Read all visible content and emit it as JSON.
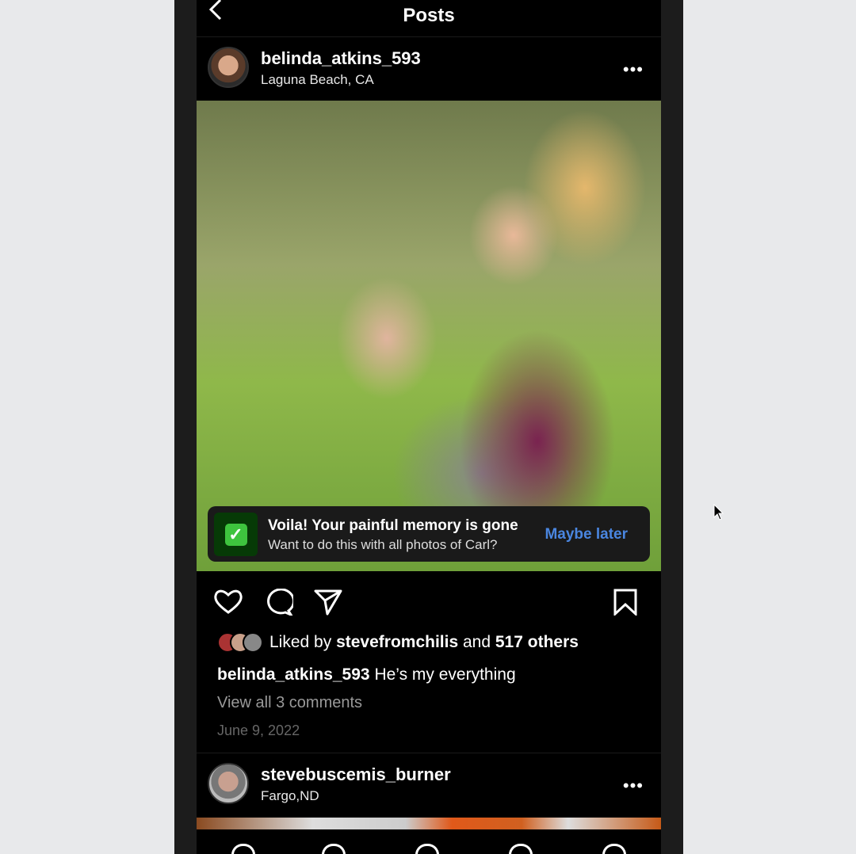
{
  "header": {
    "title": "Posts"
  },
  "post": {
    "username": "belinda_atkins_593",
    "location": "Laguna Beach, CA",
    "toast": {
      "title": "Voila! Your painful memory is gone",
      "subtitle": "Want to do this with all photos of Carl?",
      "action": "Maybe later",
      "action_color": "#4a86e0"
    },
    "likes": {
      "prefix": "Liked by",
      "user": "stevefromchilis",
      "middle": "and",
      "others": "517 others"
    },
    "caption": {
      "user": "belinda_atkins_593",
      "text": "He’s my everything"
    },
    "comments": "View all 3 comments",
    "date": "June 9, 2022"
  },
  "post2": {
    "username": "stevebuscemis_burner",
    "location": "Fargo,ND"
  },
  "nav": [
    "home-icon",
    "search-icon",
    "reels-icon",
    "shop-icon",
    "profile-icon"
  ]
}
